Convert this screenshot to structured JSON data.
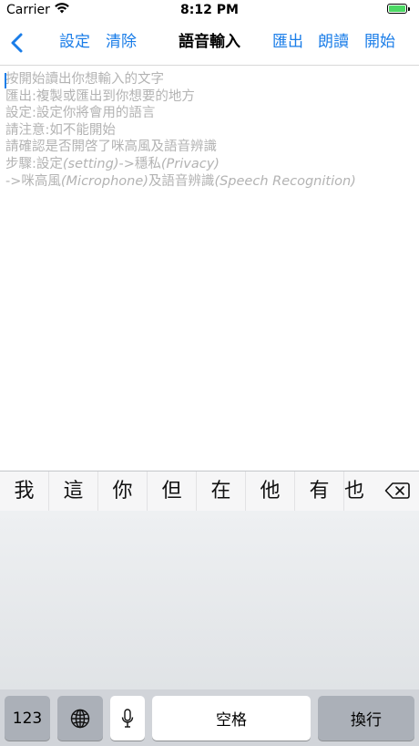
{
  "status_bar": {
    "carrier": "Carrier",
    "time": "8:12 PM",
    "wifi_icon": "wifi-icon",
    "battery_icon": "battery-full-icon"
  },
  "nav_bar": {
    "back_icon": "chevron-left-icon",
    "settings_label": "設定",
    "clear_label": "清除",
    "title": "語音輸入",
    "export_label": "匯出",
    "read_aloud_label": "朗讀",
    "start_label": "開始"
  },
  "text_area": {
    "placeholder_lines": [
      {
        "text": "按開始讀出你想輸入的文字"
      },
      {
        "text": "匯出:複製或匯出到你想要的地方"
      },
      {
        "text": "設定:設定你將會用的語言"
      },
      {
        "text": "請注意:如不能開始"
      },
      {
        "text": "請確認是否開啓了咪高風及語音辨識"
      },
      {
        "pre": "步驟:設定",
        "latin1": "(setting)",
        "mid": "->穩私",
        "latin2": "(Privacy)"
      },
      {
        "pre": "->咪高風",
        "latin1": "(Microphone)",
        "mid": "及語音辨識",
        "latin2": "(Speech Recognition)"
      }
    ]
  },
  "keyboard": {
    "candidates": [
      "我",
      "這",
      "你",
      "但",
      "在",
      "他",
      "有",
      "也"
    ],
    "delete_icon": "backspace-icon",
    "numbers_key": "123",
    "globe_icon": "globe-icon",
    "mic_icon": "microphone-icon",
    "space_key": "空格",
    "return_key": "換行"
  },
  "colors": {
    "accent": "#1a7de8",
    "placeholder": "#b3b3b3",
    "battery": "#4cd964"
  }
}
